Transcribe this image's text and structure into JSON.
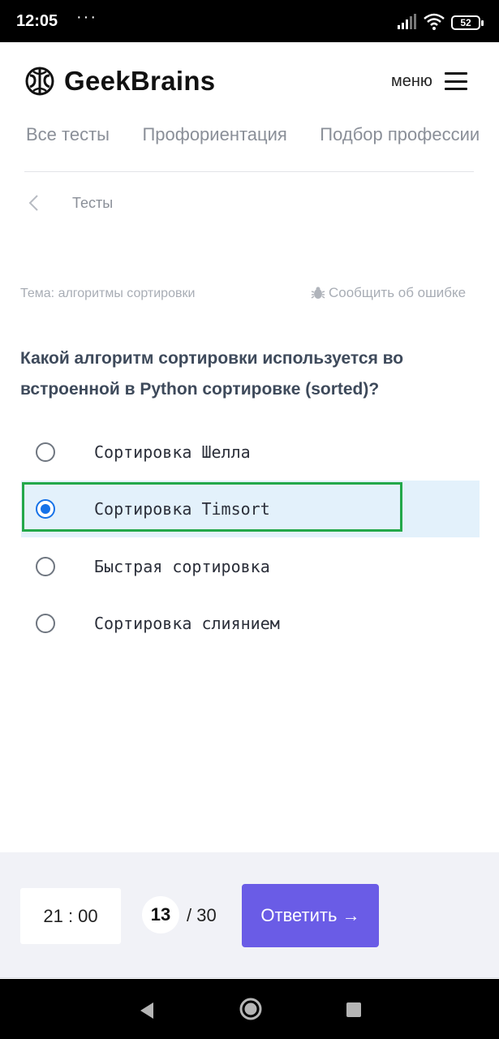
{
  "status_bar": {
    "time": "12:05",
    "dots": "···",
    "battery": "52"
  },
  "header": {
    "brand": "GeekBrains",
    "menu_label": "меню"
  },
  "tabs": [
    {
      "label": "Все тесты"
    },
    {
      "label": "Профориентация"
    },
    {
      "label": "Подбор профессии"
    }
  ],
  "breadcrumb": {
    "label": "Тесты"
  },
  "quiz": {
    "topic": "Тема: алгоритмы сортировки",
    "report_label": "Сообщить об ошибке",
    "question": "Какой алгоритм сортировки используется во встроенной в Python сортировке (sorted)?",
    "options": [
      {
        "label": "Сортировка Шелла",
        "selected": false
      },
      {
        "label": "Сортировка Timsort",
        "selected": true
      },
      {
        "label": "Быстрая сортировка",
        "selected": false
      },
      {
        "label": "Сортировка слиянием",
        "selected": false
      }
    ]
  },
  "footer": {
    "timer": "21 : 00",
    "current_question": "13",
    "total_questions": "/ 30",
    "answer_button": "Ответить →"
  },
  "colors": {
    "accent_button": "#6a5ce6",
    "radio_selected": "#1672e8",
    "selected_row_bg": "#e3f1fb",
    "highlight_border": "#23a84a"
  }
}
